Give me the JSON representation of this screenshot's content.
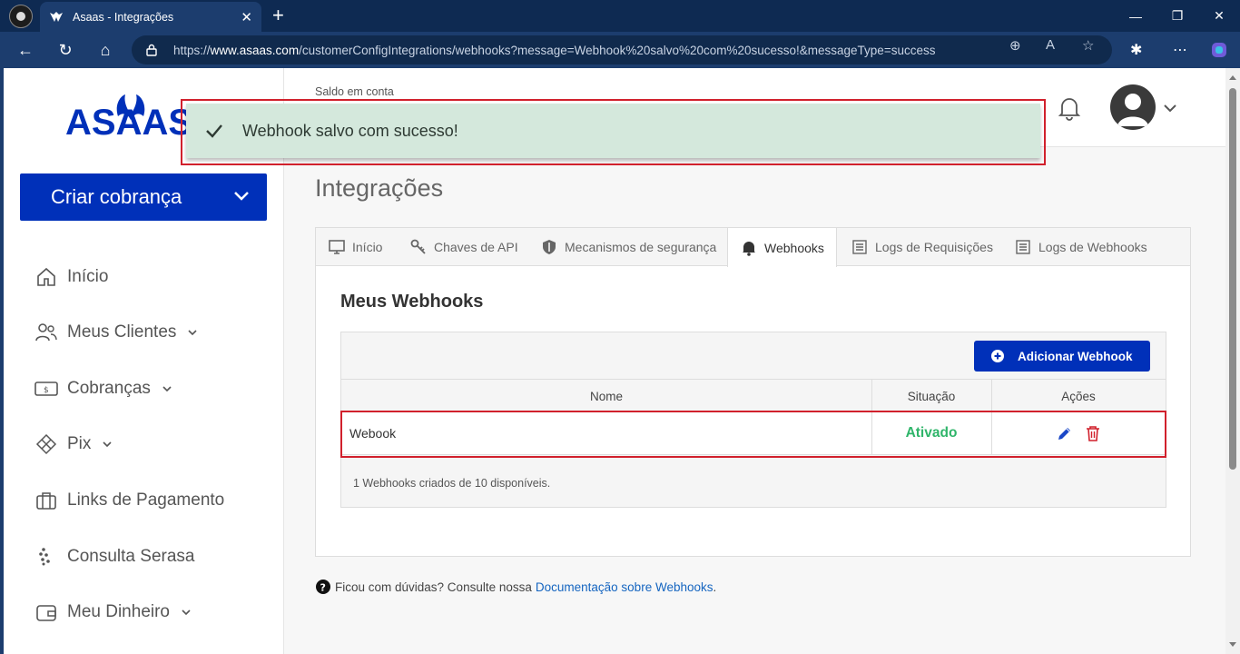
{
  "browser": {
    "tab_title": "Asaas - Integrações",
    "url_prefix": "https://",
    "url_host": "www.asaas.com",
    "url_path": "/customerConfigIntegrations/webhooks?message=Webhook%20salvo%20com%20sucesso!&messageType=success"
  },
  "sidebar": {
    "logo_text": "ASAAS",
    "create_button": "Criar cobrança",
    "items": [
      {
        "label": "Início",
        "icon": "home-icon"
      },
      {
        "label": "Meus Clientes",
        "icon": "users-icon"
      },
      {
        "label": "Cobranças",
        "icon": "money-icon"
      },
      {
        "label": "Pix",
        "icon": "pix-icon"
      },
      {
        "label": "Links de Pagamento",
        "icon": "briefcase-icon"
      },
      {
        "label": "Consulta Serasa",
        "icon": "serasa-icon"
      },
      {
        "label": "Meu Dinheiro",
        "icon": "wallet-icon"
      }
    ]
  },
  "header": {
    "saldo_label": "Saldo em conta"
  },
  "toast": {
    "message": "Webhook salvo com sucesso!"
  },
  "main": {
    "title": "Integrações",
    "tabs": [
      {
        "label": "Início",
        "icon": "monitor-icon"
      },
      {
        "label": "Chaves de API",
        "icon": "key-icon"
      },
      {
        "label": "Mecanismos de segurança",
        "icon": "shield-icon"
      },
      {
        "label": "Webhooks",
        "icon": "bell-icon"
      },
      {
        "label": "Logs de Requisições",
        "icon": "list-icon"
      },
      {
        "label": "Logs de Webhooks",
        "icon": "list-icon"
      }
    ],
    "section_title": "Meus Webhooks",
    "add_button": "Adicionar Webhook",
    "table": {
      "columns": [
        "Nome",
        "Situação",
        "Ações"
      ],
      "rows": [
        {
          "name": "Webook",
          "status": "Ativado"
        }
      ]
    },
    "count_text": "1 Webhooks criados de 10 disponíveis.",
    "help_text": "Ficou com dúvidas? Consulte nossa",
    "help_link": "Documentação sobre Webhooks",
    "help_end": "."
  },
  "colors": {
    "brand_blue": "#0030b9",
    "status_green": "#2fb56a",
    "highlight_red": "#d1202c",
    "toast_bg": "#d4e8dc"
  }
}
